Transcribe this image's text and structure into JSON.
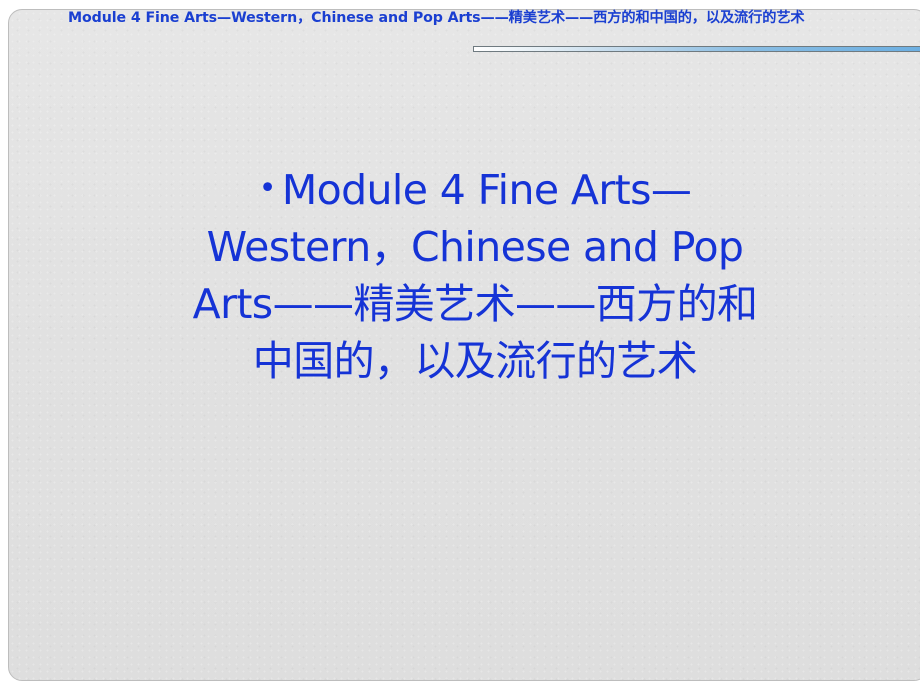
{
  "slide": {
    "header": {
      "title": "Module 4   Fine Arts—Western，Chinese and Pop Arts——精美艺术——西方的和中国的，以及流行的艺术"
    },
    "main": {
      "bullet": "•",
      "lines": [
        "Module 4    Fine Arts—",
        "Western，Chinese and Pop",
        "Arts——精美艺术——西方的和",
        "中国的，以及流行的艺术"
      ]
    },
    "colors": {
      "title_blue": "#1a3fd1",
      "body_blue": "#1533d6",
      "background_gray": "#e1e1e1",
      "rule_blue": "#6aaee2"
    }
  }
}
